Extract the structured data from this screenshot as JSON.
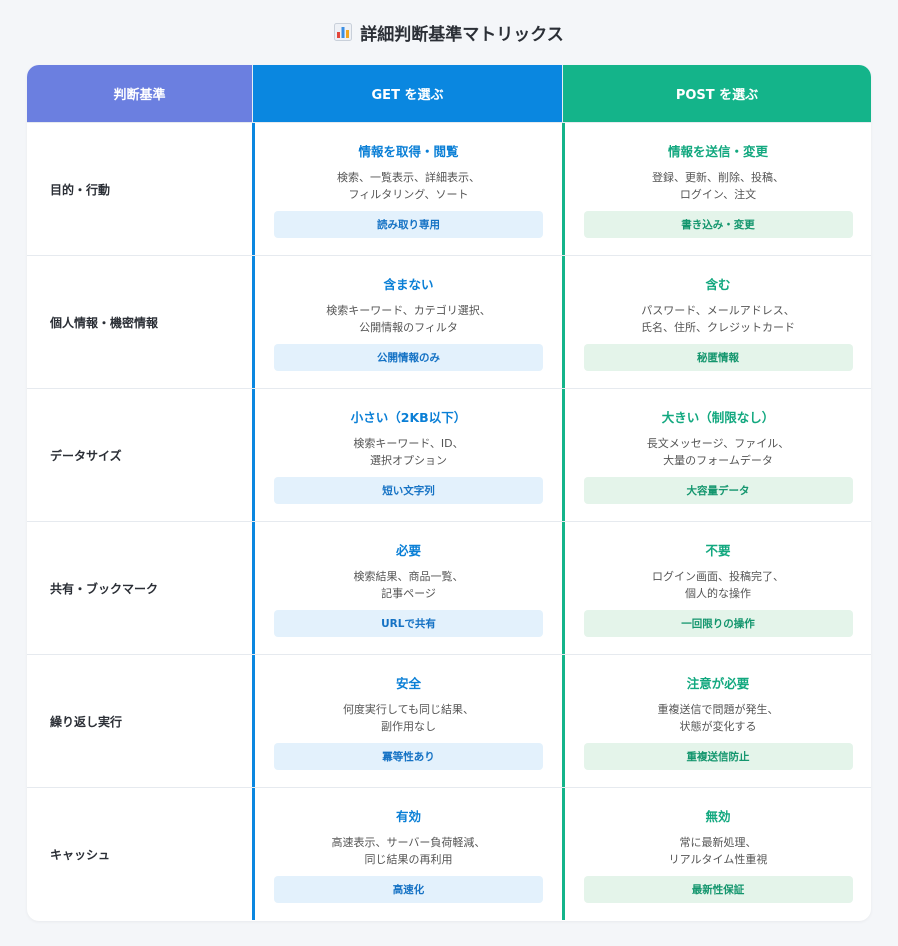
{
  "title": "詳細判断基準マトリックス",
  "title_icon": "bar-chart-icon",
  "colors": {
    "criteria_header": "#6b7fe0",
    "get": "#0a87e0",
    "post": "#14b48a"
  },
  "header": {
    "criteria": "判断基準",
    "get": "GET を選ぶ",
    "post": "POST を選ぶ"
  },
  "rows": [
    {
      "criterion": "目的・行動",
      "get": {
        "title": "情報を取得・閲覧",
        "desc1": "検索、一覧表示、詳細表示、",
        "desc2": "フィルタリング、ソート",
        "tag": "読み取り専用"
      },
      "post": {
        "title": "情報を送信・変更",
        "desc1": "登録、更新、削除、投稿、",
        "desc2": "ログイン、注文",
        "tag": "書き込み・変更"
      }
    },
    {
      "criterion": "個人情報・機密情報",
      "get": {
        "title": "含まない",
        "desc1": "検索キーワード、カテゴリ選択、",
        "desc2": "公開情報のフィルタ",
        "tag": "公開情報のみ"
      },
      "post": {
        "title": "含む",
        "desc1": "パスワード、メールアドレス、",
        "desc2": "氏名、住所、クレジットカード",
        "tag": "秘匿情報"
      }
    },
    {
      "criterion": "データサイズ",
      "get": {
        "title": "小さい（2KB以下）",
        "desc1": "検索キーワード、ID、",
        "desc2": "選択オプション",
        "tag": "短い文字列"
      },
      "post": {
        "title": "大きい（制限なし）",
        "desc1": "長文メッセージ、ファイル、",
        "desc2": "大量のフォームデータ",
        "tag": "大容量データ"
      }
    },
    {
      "criterion": "共有・ブックマーク",
      "get": {
        "title": "必要",
        "desc1": "検索結果、商品一覧、",
        "desc2": "記事ページ",
        "tag": "URLで共有"
      },
      "post": {
        "title": "不要",
        "desc1": "ログイン画面、投稿完了、",
        "desc2": "個人的な操作",
        "tag": "一回限りの操作"
      }
    },
    {
      "criterion": "繰り返し実行",
      "get": {
        "title": "安全",
        "desc1": "何度実行しても同じ結果、",
        "desc2": "副作用なし",
        "tag": "冪等性あり"
      },
      "post": {
        "title": "注意が必要",
        "desc1": "重複送信で問題が発生、",
        "desc2": "状態が変化する",
        "tag": "重複送信防止"
      }
    },
    {
      "criterion": "キャッシュ",
      "get": {
        "title": "有効",
        "desc1": "高速表示、サーバー負荷軽減、",
        "desc2": "同じ結果の再利用",
        "tag": "高速化"
      },
      "post": {
        "title": "無効",
        "desc1": "常に最新処理、",
        "desc2": "リアルタイム性重視",
        "tag": "最新性保証"
      }
    }
  ]
}
